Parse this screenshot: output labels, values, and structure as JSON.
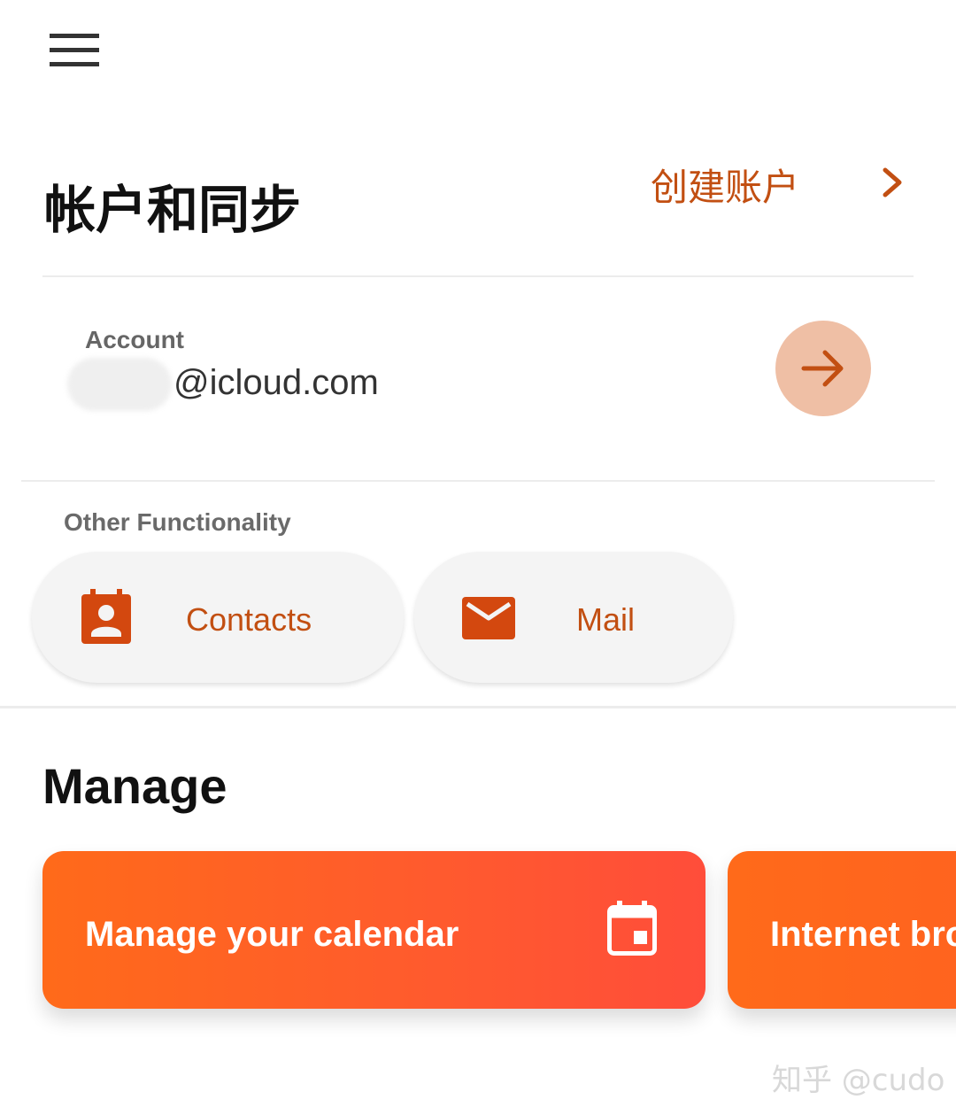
{
  "header": {
    "menu_icon": "hamburger-menu-icon",
    "title": "帐户和同步",
    "create_account_label": "创建账户",
    "chevron_icon": "chevron-right-icon"
  },
  "account": {
    "label": "Account",
    "email_visible": "@icloud.com",
    "go_icon": "arrow-right-icon"
  },
  "other_functionality": {
    "label": "Other Functionality",
    "items": [
      {
        "label": "Contacts",
        "icon": "contacts-icon"
      },
      {
        "label": "Mail",
        "icon": "mail-icon"
      }
    ]
  },
  "manage": {
    "title": "Manage",
    "cards": [
      {
        "label": "Manage your calendar",
        "icon": "calendar-icon"
      },
      {
        "label": "Internet bro"
      }
    ]
  },
  "watermark": "知乎 @cudo",
  "colors": {
    "accent": "#c24f12",
    "card_gradient_start": "#ff6a1a",
    "card_gradient_end": "#ff4d3a",
    "account_button_bg": "#efbfa5"
  }
}
